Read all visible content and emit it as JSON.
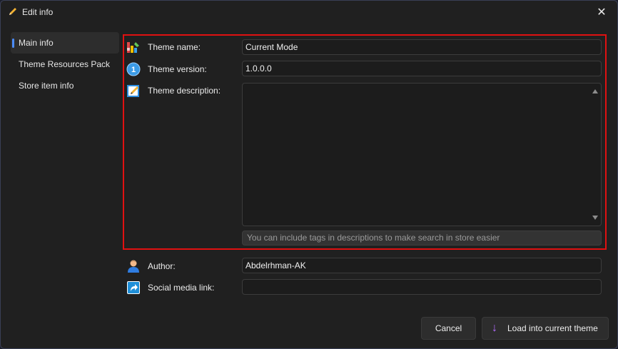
{
  "window": {
    "title": "Edit info",
    "close_symbol": "✕"
  },
  "sidebar": {
    "items": [
      {
        "label": "Main info",
        "active": true
      },
      {
        "label": "Theme Resources Pack",
        "active": false
      },
      {
        "label": "Store item info",
        "active": false
      }
    ]
  },
  "form": {
    "theme_name": {
      "label": "Theme name:",
      "value": "Current Mode",
      "icon": "palette-icon"
    },
    "theme_version": {
      "label": "Theme version:",
      "value": "1.0.0.0",
      "icon": "version-badge-icon",
      "badge_text": "1"
    },
    "theme_description": {
      "label": "Theme description:",
      "value": "",
      "icon": "notepad-pencil-icon"
    },
    "description_hint": "You can include tags in descriptions to make search in store easier",
    "author": {
      "label": "Author:",
      "value": "Abdelrhman-AK",
      "icon": "user-icon"
    },
    "social_link": {
      "label": "Social media link:",
      "value": "",
      "icon": "share-link-icon"
    }
  },
  "buttons": {
    "cancel": "Cancel",
    "load": "Load into current theme",
    "load_icon": "down-arrow-icon"
  },
  "colors": {
    "accent": "#4c8dff",
    "highlight": "#e01111",
    "load_arrow": "#b36bff"
  }
}
